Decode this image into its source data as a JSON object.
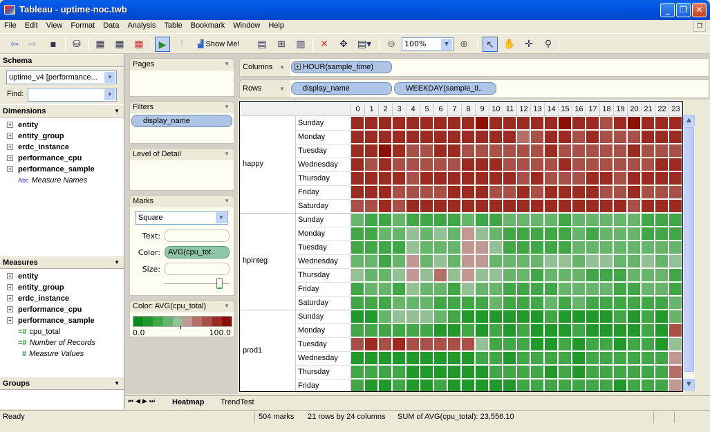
{
  "window": {
    "title": "Tableau - uptime-noc.twb",
    "min_label": "_",
    "max_label": "❐",
    "close_label": "✕"
  },
  "menu": [
    "File",
    "Edit",
    "View",
    "Format",
    "Data",
    "Analysis",
    "Table",
    "Bookmark",
    "Window",
    "Help"
  ],
  "toolbar": {
    "show_me_label": "Show Me!",
    "zoom_value": "100%",
    "icons": [
      "back-icon",
      "forward-icon",
      "save-icon",
      "connect-data-icon",
      "new-worksheet-icon",
      "duplicate-sheet-icon",
      "clear-sheet-icon",
      "auto-update-icon",
      "run-update-icon",
      "show-me-icon",
      "group-icon",
      "fit-icon",
      "sort-icon",
      "clear-icon",
      "swap-icon",
      "fit-width-icon",
      "zoom-out-icon",
      "zoom-in-icon",
      "pointer-tool-icon",
      "pan-tool-icon",
      "crosshair-tool-icon",
      "zoom-tool-icon"
    ]
  },
  "schema": {
    "title": "Schema",
    "datasource": "uptime_v4 [performance...",
    "find_label": "Find:",
    "find_value": ""
  },
  "dimensions": {
    "title": "Dimensions",
    "items": [
      "entity",
      "entity_group",
      "erdc_instance",
      "performance_cpu",
      "performance_sample"
    ],
    "extra": {
      "type": "Abc",
      "label": "Measure Names"
    }
  },
  "measures": {
    "title": "Measures",
    "items": [
      "entity",
      "entity_group",
      "erdc_instance",
      "performance_cpu",
      "performance_sample"
    ],
    "fields": [
      {
        "type": "=#",
        "label": "cpu_total",
        "italic": false
      },
      {
        "type": "=#",
        "label": "Number of Records",
        "italic": true
      },
      {
        "type": "#",
        "label": "Measure Values",
        "italic": true
      }
    ]
  },
  "groups": {
    "title": "Groups"
  },
  "cards": {
    "pages": "Pages",
    "filters": "Filters",
    "filter_pill": "display_name",
    "lod": "Level of Detail",
    "marks": "Marks",
    "mark_type": "Square",
    "text_label": "Text:",
    "color_label": "Color:",
    "color_pill": "AVG(cpu_tot..",
    "size_label": "Size:",
    "legend_title": "Color: AVG(cpu_total)",
    "legend_min": "0.0",
    "legend_max": "100.0",
    "legend_colors": [
      "#0a8a1a",
      "#20992a",
      "#41a646",
      "#66b56b",
      "#93c195",
      "#c09894",
      "#b47068",
      "#a85048",
      "#9b2a20",
      "#8b1000"
    ]
  },
  "shelves": {
    "columns_label": "Columns",
    "columns_pill": "HOUR(sample_time)",
    "rows_label": "Rows",
    "rows_pills": [
      "display_name",
      "WEEKDAY(sample_ti.."
    ]
  },
  "tabs": [
    "Heatmap",
    "TrendTest"
  ],
  "active_tab": "Heatmap",
  "status": {
    "ready": "Ready",
    "marks": "504 marks",
    "dims": "21 rows by 24 columns",
    "sum": "SUM of AVG(cpu_total): 23,556.10"
  },
  "chart_data": {
    "type": "heatmap",
    "title": "Heatmap",
    "xlabel": "HOUR(sample_time)",
    "ylabel": "display_name / WEEKDAY(sample_time)",
    "color_measure": "AVG(cpu_total)",
    "color_range": [
      0,
      100
    ],
    "color_bin_size": 10,
    "x": [
      "0",
      "1",
      "2",
      "3",
      "4",
      "5",
      "6",
      "7",
      "8",
      "9",
      "10",
      "11",
      "12",
      "13",
      "14",
      "15",
      "16",
      "17",
      "18",
      "19",
      "20",
      "21",
      "22",
      "23"
    ],
    "groups": [
      {
        "name": "happy",
        "rows": [
          {
            "day": "Sunday",
            "levels": [
              8,
              8,
              8,
              8,
              8,
              8,
              8,
              8,
              8,
              9,
              8,
              8,
              8,
              8,
              8,
              9,
              8,
              8,
              7,
              8,
              9,
              8,
              8,
              8
            ]
          },
          {
            "day": "Monday",
            "levels": [
              8,
              8,
              8,
              8,
              8,
              8,
              8,
              8,
              8,
              8,
              8,
              8,
              6,
              7,
              8,
              8,
              7,
              8,
              7,
              7,
              7,
              8,
              8,
              8
            ]
          },
          {
            "day": "Tuesday",
            "levels": [
              8,
              8,
              9,
              8,
              7,
              7,
              8,
              8,
              7,
              7,
              7,
              7,
              7,
              7,
              8,
              7,
              7,
              7,
              7,
              7,
              8,
              7,
              7,
              7
            ]
          },
          {
            "day": "Wednesday",
            "levels": [
              8,
              7,
              8,
              7,
              7,
              7,
              7,
              7,
              8,
              8,
              8,
              7,
              7,
              7,
              7,
              8,
              7,
              7,
              7,
              7,
              7,
              7,
              8,
              8
            ]
          },
          {
            "day": "Thursday",
            "levels": [
              8,
              8,
              8,
              8,
              7,
              8,
              8,
              8,
              8,
              8,
              8,
              8,
              7,
              8,
              7,
              7,
              7,
              8,
              8,
              7,
              8,
              8,
              8,
              8
            ]
          },
          {
            "day": "Friday",
            "levels": [
              8,
              8,
              8,
              7,
              7,
              7,
              7,
              8,
              8,
              8,
              7,
              7,
              8,
              7,
              8,
              8,
              8,
              8,
              7,
              7,
              8,
              7,
              7,
              7
            ]
          },
          {
            "day": "Saturday",
            "levels": [
              7,
              7,
              8,
              7,
              8,
              8,
              8,
              8,
              8,
              8,
              8,
              8,
              8,
              8,
              8,
              8,
              8,
              8,
              8,
              8,
              7,
              8,
              8,
              8
            ]
          }
        ]
      },
      {
        "name": "hpinteg",
        "rows": [
          {
            "day": "Sunday",
            "levels": [
              3,
              2,
              2,
              3,
              2,
              2,
              2,
              2,
              3,
              2,
              2,
              3,
              3,
              3,
              3,
              2,
              3,
              3,
              3,
              3,
              3,
              2,
              2,
              2
            ]
          },
          {
            "day": "Monday",
            "levels": [
              2,
              2,
              3,
              3,
              4,
              3,
              4,
              3,
              5,
              4,
              3,
              2,
              2,
              2,
              2,
              2,
              3,
              2,
              3,
              3,
              3,
              2,
              2,
              2
            ]
          },
          {
            "day": "Tuesday",
            "levels": [
              2,
              2,
              2,
              2,
              4,
              3,
              3,
              3,
              5,
              5,
              4,
              2,
              2,
              2,
              2,
              2,
              3,
              3,
              3,
              3,
              3,
              3,
              3,
              3
            ]
          },
          {
            "day": "Wednesday",
            "levels": [
              3,
              3,
              2,
              3,
              5,
              3,
              4,
              3,
              5,
              5,
              3,
              3,
              3,
              3,
              4,
              4,
              3,
              4,
              4,
              3,
              3,
              4,
              3,
              4
            ]
          },
          {
            "day": "Thursday",
            "levels": [
              4,
              3,
              3,
              4,
              5,
              4,
              6,
              4,
              5,
              4,
              4,
              3,
              3,
              2,
              3,
              3,
              3,
              2,
              2,
              2,
              3,
              3,
              3,
              2
            ]
          },
          {
            "day": "Friday",
            "levels": [
              2,
              3,
              3,
              2,
              4,
              3,
              3,
              2,
              4,
              3,
              3,
              2,
              2,
              2,
              2,
              3,
              3,
              3,
              3,
              2,
              2,
              3,
              3,
              2
            ]
          },
          {
            "day": "Saturday",
            "levels": [
              2,
              2,
              2,
              3,
              3,
              3,
              2,
              2,
              2,
              2,
              3,
              2,
              2,
              2,
              3,
              2,
              3,
              2,
              2,
              2,
              2,
              2,
              2,
              3
            ]
          }
        ]
      },
      {
        "name": "prod1",
        "rows": [
          {
            "day": "Sunday",
            "levels": [
              1,
              1,
              3,
              4,
              4,
              4,
              3,
              2,
              1,
              1,
              1,
              1,
              1,
              1,
              2,
              1,
              1,
              1,
              1,
              2,
              1,
              2,
              1,
              3
            ]
          },
          {
            "day": "Monday",
            "levels": [
              2,
              2,
              2,
              2,
              2,
              2,
              1,
              1,
              2,
              1,
              2,
              1,
              2,
              1,
              1,
              1,
              2,
              1,
              1,
              1,
              1,
              2,
              1,
              7
            ]
          },
          {
            "day": "Tuesday",
            "levels": [
              7,
              8,
              7,
              8,
              7,
              7,
              7,
              7,
              7,
              4,
              2,
              2,
              2,
              1,
              1,
              2,
              1,
              2,
              2,
              1,
              2,
              2,
              1,
              4
            ]
          },
          {
            "day": "Wednesday",
            "levels": [
              1,
              1,
              1,
              1,
              1,
              1,
              1,
              1,
              1,
              2,
              2,
              1,
              2,
              2,
              2,
              2,
              1,
              2,
              2,
              2,
              2,
              2,
              2,
              5
            ]
          },
          {
            "day": "Thursday",
            "levels": [
              2,
              2,
              2,
              2,
              1,
              1,
              1,
              1,
              1,
              1,
              2,
              2,
              2,
              2,
              1,
              2,
              1,
              2,
              2,
              2,
              2,
              2,
              2,
              6
            ]
          },
          {
            "day": "Friday",
            "levels": [
              2,
              1,
              1,
              2,
              1,
              1,
              2,
              1,
              1,
              1,
              1,
              1,
              2,
              2,
              2,
              2,
              2,
              2,
              2,
              1,
              2,
              2,
              2,
              5
            ]
          }
        ]
      }
    ]
  }
}
